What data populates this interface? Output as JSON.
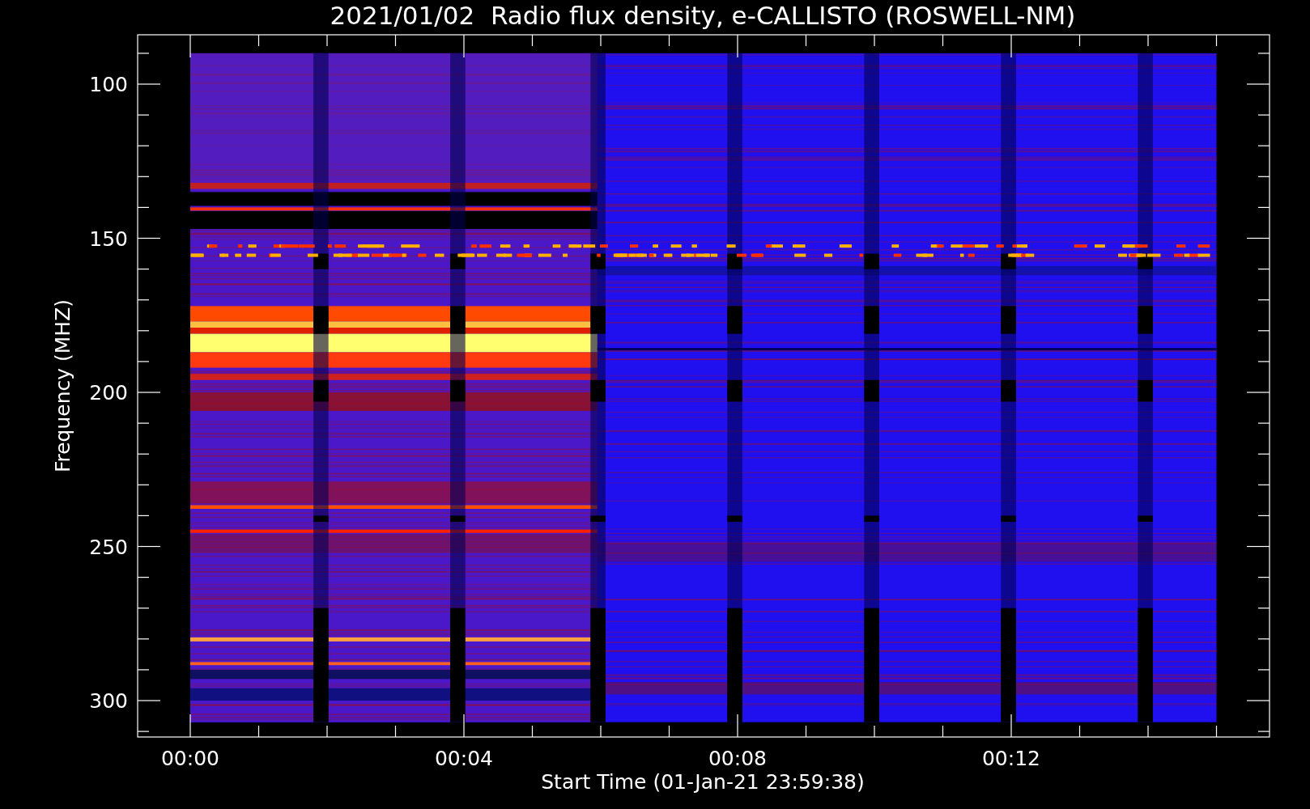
{
  "title": "2021/01/02  Radio flux density, e-CALLISTO (ROSWELL-NM)",
  "y_axis": {
    "label": "Frequency (MHZ)",
    "ticks": [
      "100",
      "150",
      "200",
      "250",
      "300"
    ]
  },
  "x_axis": {
    "label": "Start Time (01-Jan-21 23:59:38)",
    "ticks": [
      "00:00",
      "00:04",
      "00:08",
      "00:12"
    ]
  }
}
